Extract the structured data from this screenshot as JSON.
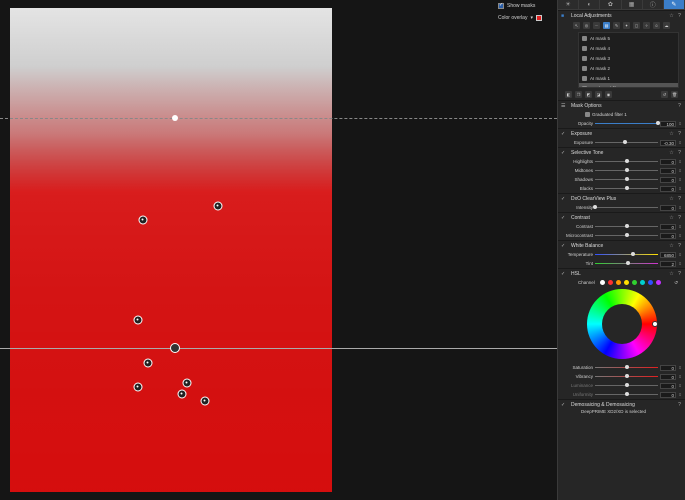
{
  "viewer": {
    "show_masks_label": "Show masks",
    "overlay_label": "Color overlay",
    "overlay_color": "#e02020"
  },
  "panel": {
    "tabs": [
      "sun-icon",
      "sliders-icon",
      "palette-icon",
      "grid-icon",
      "info-icon",
      "brush-icon"
    ],
    "local_adjustments": {
      "title": "Local Adjustments",
      "masks": [
        {
          "label": "AI mask 5"
        },
        {
          "label": "AI mask 4"
        },
        {
          "label": "AI mask 3"
        },
        {
          "label": "AI mask 2"
        },
        {
          "label": "AI mask 1"
        },
        {
          "label": "Graduated filter 1"
        }
      ]
    },
    "mask_options": {
      "title": "Mask Options",
      "mask_name": "Graduated filter 1",
      "opacity_label": "Opacity",
      "opacity_value": "100",
      "opacity_level": 1.0
    },
    "exposure": {
      "title": "Exposure",
      "rows": [
        {
          "label": "Exposure",
          "value": "-0.30",
          "level": 0.47
        }
      ]
    },
    "selective_tone": {
      "title": "Selective Tone",
      "rows": [
        {
          "label": "Highlights",
          "value": "0",
          "level": 0.5
        },
        {
          "label": "Midtones",
          "value": "0",
          "level": 0.5
        },
        {
          "label": "Shadows",
          "value": "0",
          "level": 0.5
        },
        {
          "label": "Blacks",
          "value": "0",
          "level": 0.5
        }
      ]
    },
    "clearview": {
      "title": "DxO ClearView Plus",
      "rows": [
        {
          "label": "Intensity",
          "value": "0",
          "level": 0.0
        }
      ]
    },
    "contrast": {
      "title": "Contrast",
      "rows": [
        {
          "label": "Contrast",
          "value": "0",
          "level": 0.5
        },
        {
          "label": "Microcontrast",
          "value": "0",
          "level": 0.5
        }
      ]
    },
    "white_balance": {
      "title": "White Balance",
      "rows": [
        {
          "label": "Temperature",
          "value": "6850",
          "level": 0.6
        },
        {
          "label": "Tint",
          "value": "2",
          "level": 0.52
        }
      ]
    },
    "hsl": {
      "title": "HSL",
      "channel_label": "Channel",
      "channel_colors": [
        "#ffffff",
        "#ff3030",
        "#ff9a00",
        "#ffe000",
        "#30d030",
        "#00d0d0",
        "#3050ff",
        "#c030ff"
      ],
      "rows": [
        {
          "label": "Saturation",
          "value": "0",
          "level": 0.5
        },
        {
          "label": "Vibrancy",
          "value": "0",
          "level": 0.5
        },
        {
          "label": "Luminance",
          "value": "0",
          "level": 0.5
        },
        {
          "label": "Uniformity",
          "value": "0",
          "level": 0.5
        }
      ]
    },
    "demosaicing": {
      "title": "Demosaicing & Demosaicing",
      "note": "DeepPRIME XD2/XD is selected"
    }
  }
}
